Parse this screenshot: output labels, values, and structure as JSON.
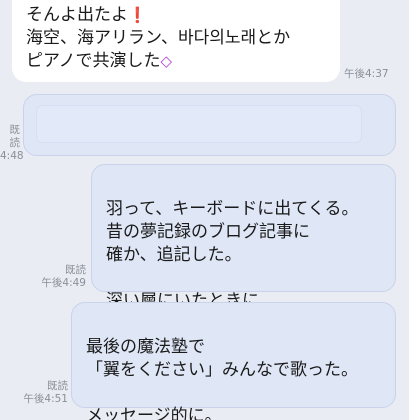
{
  "messages": [
    {
      "direction": "incoming",
      "line1": "そんよ出たよ",
      "line1_emoji": "heart-exclamation-emoji",
      "line2": "海空、海アリラン、바다의노래とか",
      "line3": "ピアノで共演した",
      "line3_emoji": "gem-emoji",
      "time": "午後4:37"
    },
    {
      "direction": "outgoing",
      "read": "既読",
      "time": "4:48",
      "content": "",
      "blurred": true
    },
    {
      "direction": "outgoing",
      "read": "既読",
      "time": "午後4:49",
      "text": "羽って、キーボードに出てくる。\n昔の夢記録のブログ記事に\n確か、追記した。\n\n深い層にいたときに。"
    },
    {
      "direction": "outgoing",
      "read": "既読",
      "time": "午後4:51",
      "text": "最後の魔法塾で\n「翼をください」みんなで歌った。\n\nメッセージ的に。"
    }
  ],
  "colors": {
    "background": "#e9ecf2",
    "incoming_bubble": "#ffffff",
    "outgoing_bubble": "#dfe6f6",
    "meta_text": "#8a8f99"
  }
}
